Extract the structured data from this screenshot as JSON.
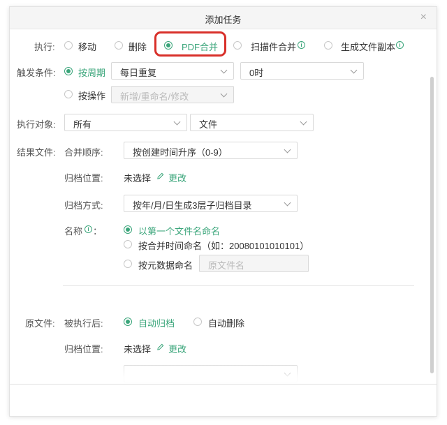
{
  "dialog": {
    "title": "添加任务",
    "close_glyph": "×"
  },
  "execute": {
    "label": "执行:",
    "options": [
      "移动",
      "删除",
      "PDF合并",
      "扫描件合并",
      "生成文件副本"
    ],
    "selected": "PDF合并"
  },
  "trigger": {
    "label": "触发条件:",
    "periodic_label": "按周期",
    "period_value": "每日重复",
    "time_value": "0时",
    "operation_label": "按操作",
    "operation_value": "新增/重命名/修改"
  },
  "target": {
    "label": "执行对象:",
    "scope_value": "所有",
    "type_value": "文件"
  },
  "result": {
    "label": "结果文件:",
    "merge_order_label": "合并顺序:",
    "merge_order_value": "按创建时间升序（0-9）",
    "archive_location_label": "归档位置:",
    "archive_location_value": "未选择",
    "change_link": "更改",
    "archive_method_label": "归档方式:",
    "archive_method_value": "按年/月/日生成3层子归档目录",
    "name_label": "名称",
    "name_colon": "：",
    "name_options": [
      "以第一个文件名命名",
      "按合并时间命名（如：20080101010101）",
      "按元数据命名"
    ],
    "name_selected": "以第一个文件名命名",
    "metadata_placeholder": "原文件名"
  },
  "source": {
    "label": "原文件:",
    "after_label": "被执行后:",
    "after_options": [
      "自动归档",
      "自动删除"
    ],
    "after_selected": "自动归档",
    "archive_location_label": "归档位置:",
    "archive_location_value": "未选择",
    "change_link": "更改"
  },
  "colors": {
    "accent": "#3aa57a",
    "highlight": "#d8302a"
  }
}
